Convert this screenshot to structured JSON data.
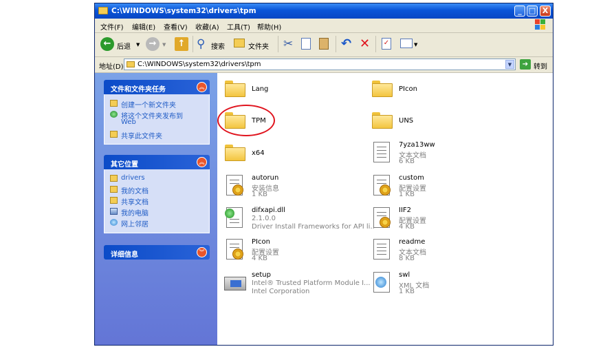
{
  "window": {
    "title": "C:\\WINDOWS\\system32\\drivers\\tpm",
    "controls": {
      "minimize": "_",
      "maximize": "□",
      "close": "X"
    }
  },
  "menu": [
    "文件(F)",
    "编辑(E)",
    "查看(V)",
    "收藏(A)",
    "工具(T)",
    "帮助(H)"
  ],
  "toolbar": {
    "back_label": "后退",
    "search_label": "搜索",
    "folders_label": "文件夹"
  },
  "address": {
    "label": "地址(D)",
    "value": "C:\\WINDOWS\\system32\\drivers\\tpm",
    "go_label": "转到"
  },
  "tasks_panel": {
    "title": "文件和文件夹任务",
    "items": [
      {
        "label": "创建一个新文件夹",
        "icon": "new-folder-icon"
      },
      {
        "label": "将这个文件夹发布到",
        "label2": "Web",
        "icon": "publish-web-icon"
      },
      {
        "label": "共享此文件夹",
        "icon": "share-folder-icon"
      }
    ]
  },
  "places_panel": {
    "title": "其它位置",
    "items": [
      {
        "label": "drivers",
        "icon": "folder-icon"
      },
      {
        "label": "我的文档",
        "icon": "my-documents-icon"
      },
      {
        "label": "共享文档",
        "icon": "shared-documents-icon"
      },
      {
        "label": "我的电脑",
        "icon": "my-computer-icon"
      },
      {
        "label": "网上邻居",
        "icon": "network-icon"
      }
    ]
  },
  "details_panel": {
    "title": "详细信息"
  },
  "files": [
    {
      "name": "Lang",
      "type": "folder"
    },
    {
      "name": "PIcon",
      "type": "folder"
    },
    {
      "name": "TPM",
      "type": "folder",
      "highlighted": true
    },
    {
      "name": "UNS",
      "type": "folder"
    },
    {
      "name": "x64",
      "type": "folder"
    },
    {
      "name": "7yza13ww",
      "type": "text",
      "line2": "文本文档",
      "line3": "6 KB"
    },
    {
      "name": "autorun",
      "type": "config",
      "line2": "安装信息",
      "line3": "1 KB"
    },
    {
      "name": "custom",
      "type": "config",
      "line2": "配置设置",
      "line3": "1 KB"
    },
    {
      "name": "difxapi.dll",
      "type": "dll",
      "line2": "2.1.0.0",
      "line3": "Driver Install Frameworks for API li..."
    },
    {
      "name": "IIF2",
      "type": "config",
      "line2": "配置设置",
      "line3": "4 KB"
    },
    {
      "name": "PIcon",
      "type": "config",
      "line2": "配置设置",
      "line3": "4 KB"
    },
    {
      "name": "readme",
      "type": "text",
      "line2": "文本文档",
      "line3": "8 KB"
    },
    {
      "name": "setup",
      "type": "setup",
      "line2": "Intel® Trusted Platform Module I...",
      "line3": "Intel Corporation"
    },
    {
      "name": "swl",
      "type": "xml",
      "line2": "XML 文档",
      "line3": "1 KB"
    }
  ]
}
